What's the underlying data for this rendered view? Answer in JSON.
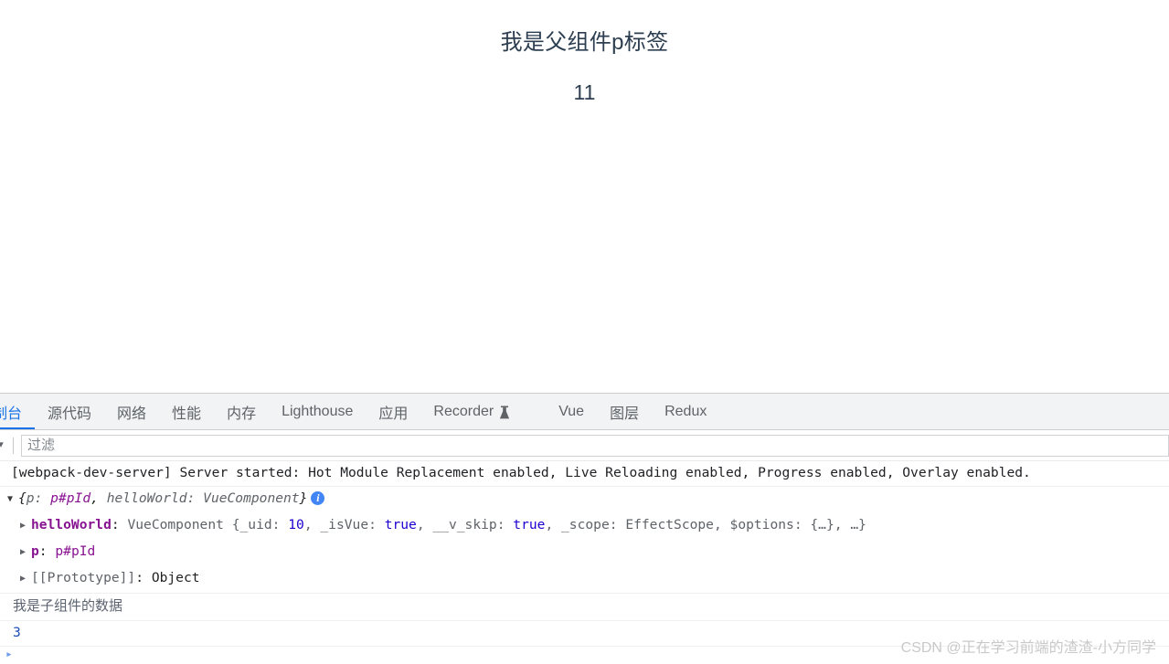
{
  "page": {
    "paragraph": "我是父组件p标签",
    "number": "11"
  },
  "devtools": {
    "tabs": [
      {
        "label": "控制台",
        "active": true,
        "icon": ""
      },
      {
        "label": "源代码",
        "active": false,
        "icon": ""
      },
      {
        "label": "网络",
        "active": false,
        "icon": ""
      },
      {
        "label": "性能",
        "active": false,
        "icon": ""
      },
      {
        "label": "内存",
        "active": false,
        "icon": ""
      },
      {
        "label": "Lighthouse",
        "active": false,
        "icon": ""
      },
      {
        "label": "应用",
        "active": false,
        "icon": ""
      },
      {
        "label": "Recorder",
        "active": false,
        "icon": "flask-icon"
      },
      {
        "label": "Vue",
        "active": false,
        "icon": ""
      },
      {
        "label": "图层",
        "active": false,
        "icon": ""
      },
      {
        "label": "Redux",
        "active": false,
        "icon": ""
      }
    ],
    "filter": {
      "placeholder": "过滤",
      "value": ""
    },
    "console": {
      "webpack_line": "[webpack-dev-server] Server started: Hot Module Replacement enabled, Live Reloading enabled, Progress enabled, Overlay enabled.",
      "object_summary": {
        "open_triangle": "▼",
        "brace_open": "{",
        "key_p": "p:",
        "value_p": "p#pId",
        "comma": ",",
        "key_hello": "helloWorld:",
        "value_hello": "VueComponent",
        "brace_close": "}",
        "info_icon": "i"
      },
      "props": [
        {
          "triangle": "▶",
          "key": "helloWorld",
          "colon": ":",
          "ctor": "VueComponent",
          "body": "{_uid: 10, _isVue: true, __v_skip: true, _scope: EffectScope, $options: {…}, …}"
        },
        {
          "triangle": "▶",
          "key": "p",
          "colon": ":",
          "ctor": "",
          "body": "p#pId"
        },
        {
          "triangle": "▶",
          "key": "[[Prototype]]",
          "colon": ":",
          "ctor": "",
          "body": "Object"
        }
      ],
      "child_data_line": "我是子组件的数据",
      "number_line": "3",
      "prompt_symbol": "▸"
    }
  },
  "watermark": "CSDN @正在学习前端的渣渣-小方同学",
  "colors": {
    "accent": "#1a73e8",
    "tabbar_bg": "#f1f3f4",
    "dom_ref": "#881391",
    "number": "#1c00cf",
    "info_badge": "#4285f4",
    "page_text": "#2c3e50"
  }
}
